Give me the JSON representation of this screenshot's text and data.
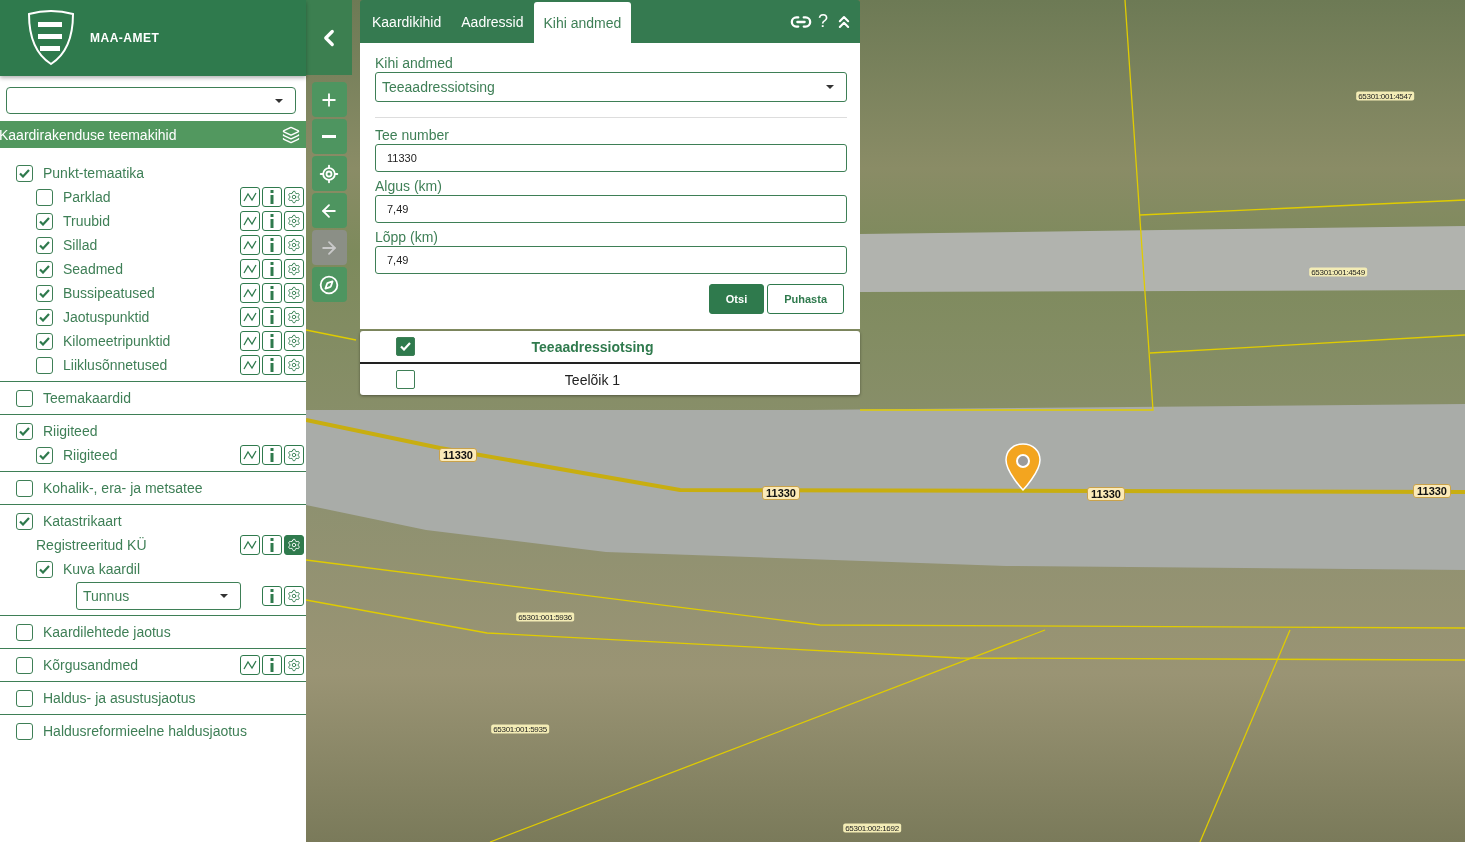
{
  "header": {
    "title": "MAA-AMET"
  },
  "section_title": "Kaardirakenduse teemakihid",
  "groups": [
    {
      "label": "Punkt-temaatika",
      "checked": true,
      "children": [
        {
          "kind": "checkbox",
          "label": "Parklad",
          "checked": false,
          "tools": [
            {
              "kind": "chart",
              "on": false
            },
            {
              "kind": "info",
              "on": false
            },
            {
              "kind": "settings",
              "on": false
            }
          ]
        },
        {
          "kind": "checkbox",
          "label": "Truubid",
          "checked": true,
          "tools": [
            {
              "kind": "chart",
              "on": false
            },
            {
              "kind": "info",
              "on": false
            },
            {
              "kind": "settings",
              "on": false
            }
          ]
        },
        {
          "kind": "checkbox",
          "label": "Sillad",
          "checked": true,
          "tools": [
            {
              "kind": "chart",
              "on": false
            },
            {
              "kind": "info",
              "on": false
            },
            {
              "kind": "settings",
              "on": false
            }
          ]
        },
        {
          "kind": "checkbox",
          "label": "Seadmed",
          "checked": true,
          "tools": [
            {
              "kind": "chart",
              "on": false
            },
            {
              "kind": "info",
              "on": false
            },
            {
              "kind": "settings",
              "on": false
            }
          ]
        },
        {
          "kind": "checkbox",
          "label": "Bussipeatused",
          "checked": true,
          "tools": [
            {
              "kind": "chart",
              "on": false
            },
            {
              "kind": "info",
              "on": false
            },
            {
              "kind": "settings",
              "on": false
            }
          ]
        },
        {
          "kind": "checkbox",
          "label": "Jaotuspunktid",
          "checked": true,
          "tools": [
            {
              "kind": "chart",
              "on": false
            },
            {
              "kind": "info",
              "on": false
            },
            {
              "kind": "settings",
              "on": false
            }
          ]
        },
        {
          "kind": "checkbox",
          "label": "Kilomeetripunktid",
          "checked": true,
          "tools": [
            {
              "kind": "chart",
              "on": false
            },
            {
              "kind": "info",
              "on": false
            },
            {
              "kind": "settings",
              "on": false
            }
          ]
        },
        {
          "kind": "checkbox",
          "label": "Liiklusõnnetused",
          "checked": false,
          "tools": [
            {
              "kind": "chart",
              "on": false
            },
            {
              "kind": "info",
              "on": false
            },
            {
              "kind": "settings",
              "on": false
            }
          ]
        }
      ]
    },
    {
      "label": "Teemakaardid",
      "checked": false
    },
    {
      "label": "Riigiteed",
      "checked": true,
      "children": [
        {
          "kind": "checkbox",
          "label": "Riigiteed",
          "checked": true,
          "tools": [
            {
              "kind": "chart",
              "on": false
            },
            {
              "kind": "info",
              "on": false
            },
            {
              "kind": "settings",
              "on": false
            }
          ]
        }
      ]
    },
    {
      "label": "Kohalik-, era- ja metsatee",
      "checked": false
    },
    {
      "label": "Katastrikaart",
      "checked": true,
      "children": [
        {
          "kind": "heading",
          "label": "Registreeritud KÜ",
          "tools": [
            {
              "kind": "chart",
              "on": false
            },
            {
              "kind": "info",
              "on": false
            },
            {
              "kind": "settings",
              "on": true
            }
          ]
        },
        {
          "kind": "checkbox",
          "label": "Kuva kaardil",
          "checked": true
        },
        {
          "kind": "select",
          "value": "Tunnus",
          "tools": [
            {
              "kind": "info",
              "on": false
            },
            {
              "kind": "settings",
              "on": false
            }
          ]
        }
      ]
    },
    {
      "label": "Kaardilehtede jaotus",
      "checked": false
    },
    {
      "label": "Kõrgusandmed",
      "checked": false,
      "tools": [
        {
          "kind": "chart",
          "on": false
        },
        {
          "kind": "info",
          "on": false
        },
        {
          "kind": "settings",
          "on": false
        }
      ]
    },
    {
      "label": "Haldus- ja asustusjaotus",
      "checked": false
    },
    {
      "label": "Haldusreformieelne haldusjaotus",
      "checked": false
    }
  ],
  "map_tools": [
    {
      "kind": "zoom_in",
      "disabled": false
    },
    {
      "kind": "zoom_out",
      "disabled": false
    },
    {
      "kind": "locate",
      "disabled": false
    },
    {
      "kind": "back",
      "disabled": false
    },
    {
      "kind": "forward",
      "disabled": true
    },
    {
      "kind": "compass",
      "disabled": false
    }
  ],
  "panel": {
    "tabs": [
      {
        "label": "Kaardikihid",
        "selected": false
      },
      {
        "label": "Aadressid",
        "selected": false
      },
      {
        "label": "Kihi andmed",
        "selected": true
      }
    ],
    "help": "?",
    "layer_label": "Kihi andmed",
    "layer_value": "Teeaadressiotsing",
    "fields": [
      {
        "label": "Tee number",
        "value": "11330"
      },
      {
        "label": "Algus (km)",
        "value": "7,49"
      },
      {
        "label": "Lõpp (km)",
        "value": "7,49"
      }
    ],
    "buttons": [
      {
        "label": "Otsi",
        "kind": "primary"
      },
      {
        "label": "Puhasta",
        "kind": "secondary"
      }
    ],
    "results": [
      {
        "label": "Teeaadressiotsing",
        "checked": true,
        "kind": "header"
      },
      {
        "label": "Teelõik 1",
        "checked": false,
        "kind": "row"
      }
    ]
  },
  "map": {
    "road_labels": [
      "11330",
      "11330",
      "11330",
      "11330"
    ],
    "parcel_labels": [
      "65301:001:4547",
      "65301:001:4549",
      "65301:001:5936",
      "65301:001:5935",
      "65301:002:1692"
    ]
  }
}
